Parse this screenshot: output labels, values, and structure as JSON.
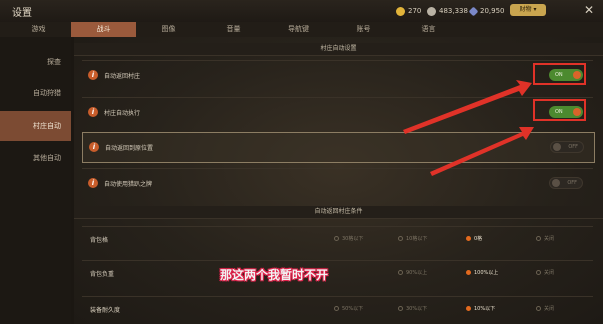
{
  "window": {
    "title": "设置"
  },
  "currency": [
    {
      "icon": "gold-coin-icon",
      "value": "270",
      "color": "#e2b43a"
    },
    {
      "icon": "silver-coin-icon",
      "value": "483,338",
      "color": "#b9b2a4"
    },
    {
      "icon": "gem-icon",
      "value": "20,950",
      "color": "#7a88c8"
    }
  ],
  "menu_button": "财物 ▾",
  "tabs": [
    {
      "label": "游戏"
    },
    {
      "label": "战斗",
      "active": true
    },
    {
      "label": "图像"
    },
    {
      "label": "音量"
    },
    {
      "label": "导航键"
    },
    {
      "label": "账号"
    },
    {
      "label": "语言"
    }
  ],
  "sidebar": [
    {
      "label": "探查"
    },
    {
      "label": "自动狩猎"
    },
    {
      "label": "村庄自动",
      "active": true
    },
    {
      "label": "其他自动"
    }
  ],
  "sections": {
    "village_auto": "村庄自动设置",
    "return_conditions": "自动返回村庄条件"
  },
  "settings": [
    {
      "label": "自动返回村庄",
      "state": "ON",
      "on": true
    },
    {
      "label": "村庄自动执行",
      "state": "ON",
      "on": true
    },
    {
      "label": "自动返回到原位置",
      "state": "OFF",
      "on": false
    },
    {
      "label": "自动使用猎趴之牌",
      "state": "OFF",
      "on": false
    }
  ],
  "conditions": [
    {
      "label": "背包格",
      "options": [
        "30格以下",
        "10格以下",
        "0格",
        "关闭"
      ],
      "selected": 2
    },
    {
      "label": "背包负重",
      "options": [
        "",
        "90%以上",
        "100%以上",
        "关闭"
      ],
      "selected": 2
    },
    {
      "label": "装备耐久度",
      "options": [
        "50%以下",
        "30%以下",
        "10%以下",
        "关闭"
      ],
      "selected": 2
    }
  ],
  "subtitle": "那这两个我暂时不开"
}
